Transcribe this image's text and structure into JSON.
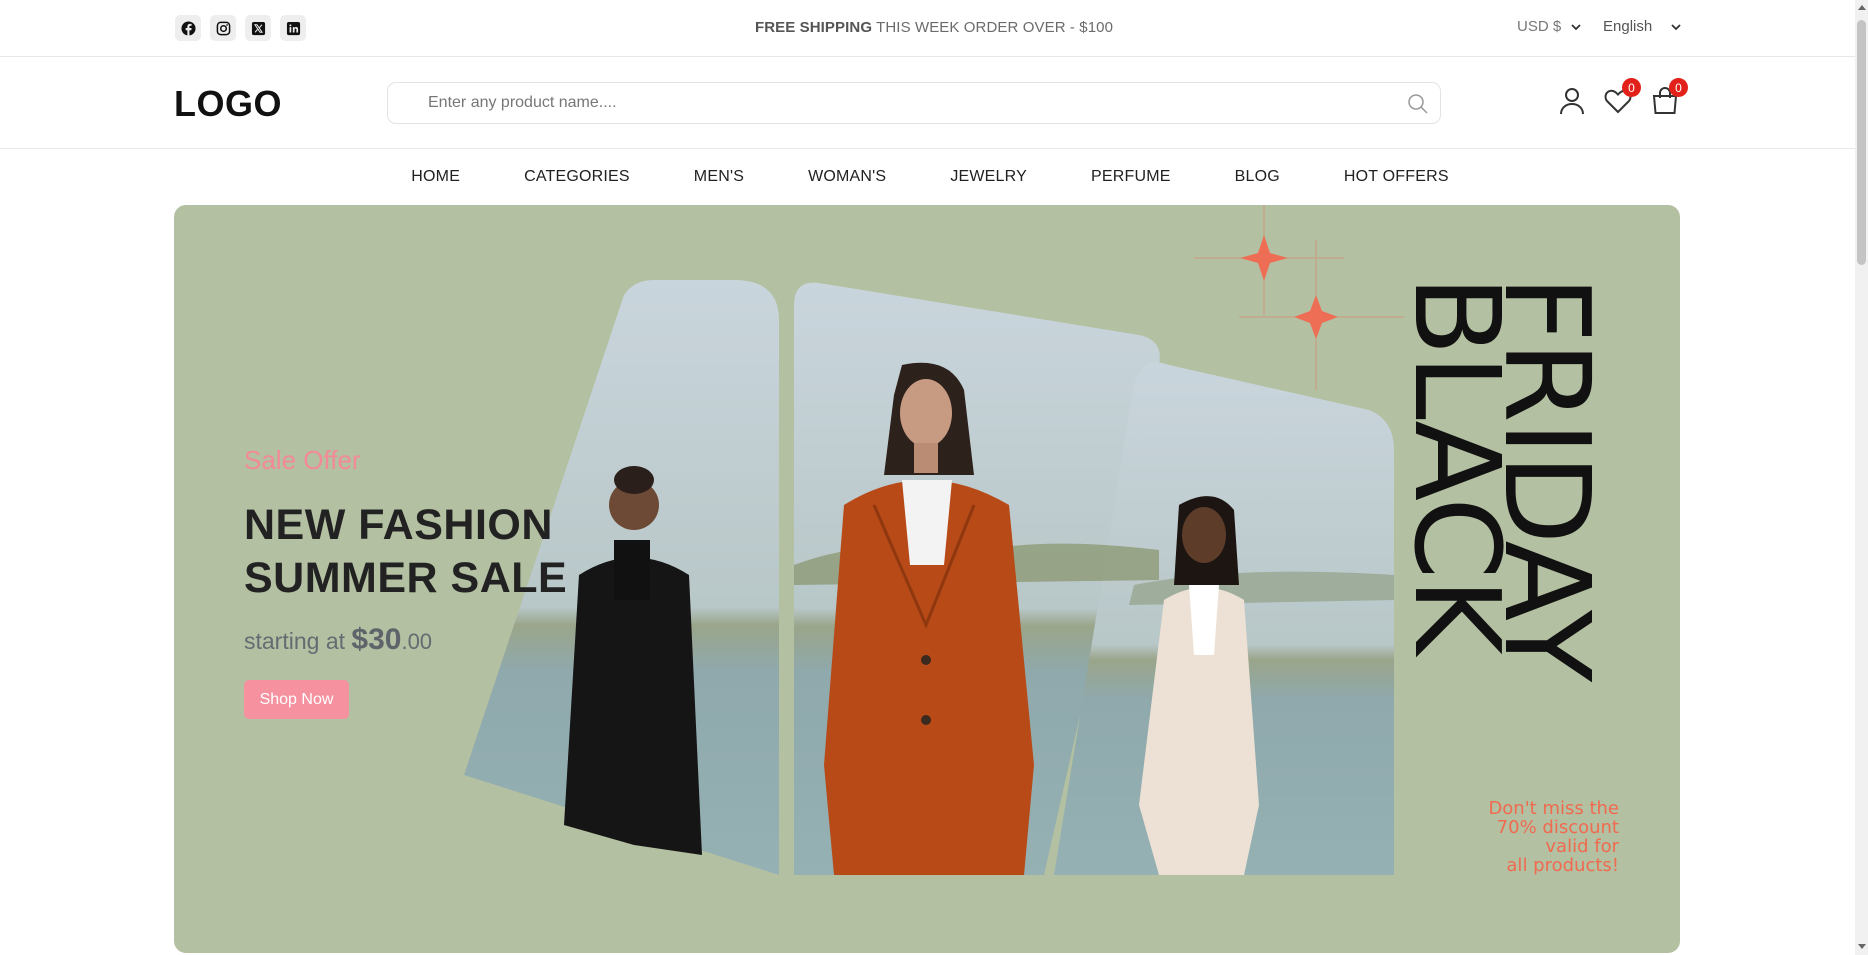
{
  "topbar": {
    "socials": [
      {
        "icon": "facebook-icon"
      },
      {
        "icon": "instagram-icon"
      },
      {
        "icon": "x-twitter-icon"
      },
      {
        "icon": "linkedin-icon"
      }
    ],
    "promo_bold": "FREE SHIPPING",
    "promo_rest": "THIS WEEK ORDER OVER - $100",
    "currency": "USD $",
    "language": "English"
  },
  "header": {
    "logo": "LOGO",
    "search_placeholder": "Enter any product name....",
    "wishlist_count": "0",
    "cart_count": "0"
  },
  "nav": {
    "items": [
      "HOME",
      "CATEGORIES",
      "MEN'S",
      "WOMAN'S",
      "JEWELRY",
      "PERFUME",
      "BLOG",
      "HOT OFFERS"
    ]
  },
  "banner": {
    "subtitle": "Sale Offer",
    "title_line1": "NEW FASHION",
    "title_line2": "SUMMER SALE",
    "starting_text": "starting at",
    "price_main": "$30",
    "price_cents": ".00",
    "button": "Shop Now",
    "art_word1": "BLACK",
    "art_word2": "FRIDAY",
    "art_note_line1": "Don't miss the",
    "art_note_line2": "70% discount",
    "art_note_line3": "valid for",
    "art_note_line4": "all products!",
    "colors": {
      "background": "#b3c0a1",
      "accent": "#f28a97",
      "art_accent": "#f06a50"
    }
  }
}
